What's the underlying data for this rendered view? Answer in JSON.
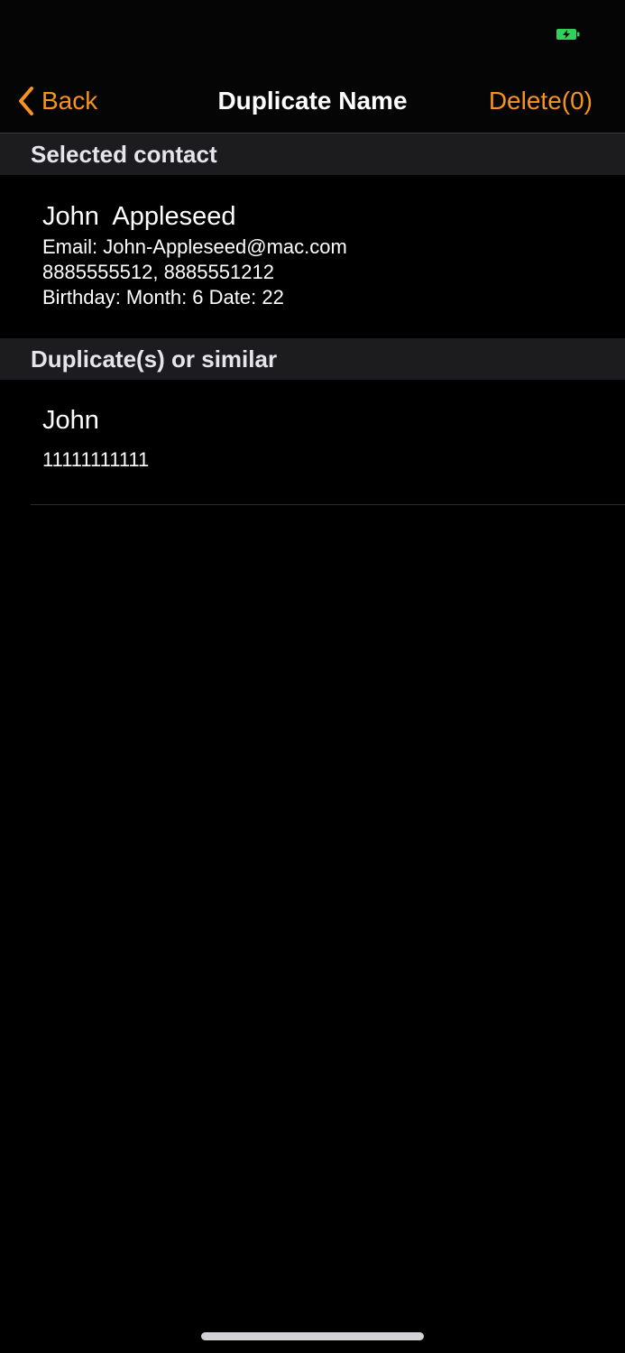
{
  "colors": {
    "accent": "#f7931e",
    "battery": "#30d158",
    "section_header_bg": "#1c1c1e"
  },
  "status_bar": {
    "battery_icon": "battery-charging-icon"
  },
  "nav": {
    "back_label": "Back",
    "back_icon": "chevron-left-icon",
    "title": "Duplicate Name",
    "delete_label": "Delete(0)"
  },
  "sections": {
    "selected": {
      "header": "Selected contact",
      "contact": {
        "name": "John  Appleseed",
        "email": "Email: John-Appleseed@mac.com",
        "phones": "8885555512, 8885551212",
        "birthday": "Birthday: Month: 6 Date: 22"
      }
    },
    "duplicates": {
      "header": "Duplicate(s) or similar",
      "items": [
        {
          "name": "John",
          "phone": "11111111111"
        }
      ]
    }
  }
}
